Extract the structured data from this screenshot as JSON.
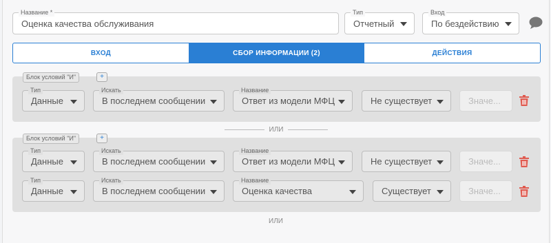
{
  "form": {
    "name": {
      "label": "Название *",
      "value": "Оценка качества обслуживания"
    },
    "type": {
      "label": "Тип",
      "value": "Отчетный"
    },
    "input": {
      "label": "Вход",
      "value": "По бездействию"
    }
  },
  "tabs": [
    {
      "label": "ВХОД",
      "active": false
    },
    {
      "label": "СБОР ИНФОРМАЦИИ (2)",
      "active": true
    },
    {
      "label": "ДЕЙСТВИЯ",
      "active": false
    }
  ],
  "block_label": "Блок условий \"И\"",
  "plus_label": "+",
  "separator": "ИЛИ",
  "labels": {
    "type": "Тип",
    "search": "Искать",
    "name": "Название"
  },
  "rows": [
    {
      "type": "Данные",
      "search": "В последнем сообщении",
      "name": "Ответ из модели МФЦ",
      "exists": "Не существует",
      "value_placeholder": "Значе..."
    },
    {
      "type": "Данные",
      "search": "В последнем сообщении",
      "name": "Ответ из модели МФЦ",
      "exists": "Не существует",
      "value_placeholder": "Значе..."
    },
    {
      "type": "Данные",
      "search": "В последнем сообщении",
      "name": "Оценка качества",
      "exists": "Существует",
      "value_placeholder": "Значе..."
    }
  ],
  "colors": {
    "accent": "#2a7fd4",
    "danger": "#e05a4f"
  }
}
